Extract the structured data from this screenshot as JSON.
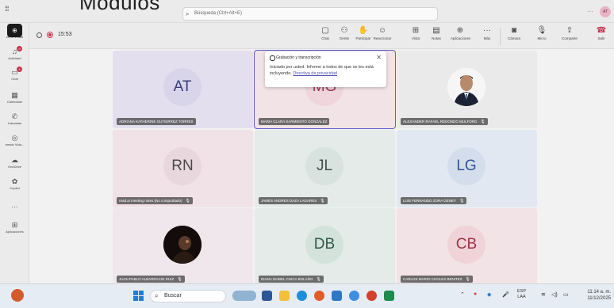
{
  "overlay_title": "Modulos",
  "titlebar": {
    "search_placeholder": "Búsqueda (Ctrl+Alt+E)",
    "more": "···",
    "avatar": "AT"
  },
  "rail": {
    "items": [
      {
        "label": "ermd Virtual",
        "icon": "teams-icon",
        "badge": ""
      },
      {
        "label": "Actividad",
        "icon": "bell-icon",
        "badge": "9"
      },
      {
        "label": "Chat",
        "icon": "chat-icon",
        "badge": "4"
      },
      {
        "label": "Calendario",
        "icon": "calendar-icon",
        "badge": ""
      },
      {
        "label": "Llamadas",
        "icon": "phone-icon",
        "badge": ""
      },
      {
        "label": "eesde Vida...",
        "icon": "lightbulb-icon",
        "badge": ""
      },
      {
        "label": "OneDrive",
        "icon": "cloud-icon",
        "badge": ""
      },
      {
        "label": "Copilot",
        "icon": "copilot-icon",
        "badge": ""
      },
      {
        "label": "···",
        "icon": "more-icon",
        "badge": ""
      },
      {
        "label": "Aplicaciones",
        "icon": "apps-icon",
        "badge": ""
      }
    ]
  },
  "toolbar": {
    "timer": "15:53",
    "buttons": [
      {
        "label": "Chat",
        "icon": "chat-icon"
      },
      {
        "label": "Gente",
        "icon": "people-icon"
      },
      {
        "label": "Participar",
        "icon": "raise-hand-icon"
      },
      {
        "label": "Reaccionar",
        "icon": "emoji-icon"
      },
      {
        "label": "Vista",
        "icon": "grid-view-icon"
      },
      {
        "label": "Notas",
        "icon": "notes-icon"
      },
      {
        "label": "Aplicaciones",
        "icon": "apps-add-icon"
      },
      {
        "label": "Más",
        "icon": "more-icon"
      },
      {
        "label": "Cámara",
        "icon": "camera-off-icon"
      },
      {
        "label": "Micro",
        "icon": "mic-icon"
      },
      {
        "label": "Comparte",
        "icon": "share-icon"
      }
    ],
    "leave": "Salir"
  },
  "popup": {
    "title": "Grabación y transcripción",
    "body": "Iniciado por usted. Informe a todos de que se les está incluyendo.",
    "link": "Directiva de privacidad"
  },
  "participants": [
    {
      "initials": "AT",
      "name": "ADRIANA KATHERINE GUTIERREZ TORRES",
      "muted": false,
      "photo": false,
      "bg": "#e3dfee",
      "avbg": "#d8d5ea",
      "avcolor": "#3a3d7a"
    },
    {
      "initials": "MG",
      "name": "MARIA CLARA SARMIENTO GONZALEZ",
      "muted": false,
      "photo": false,
      "bg": "#f2e3e7",
      "avbg": "#f0d5dc",
      "avcolor": "#9c3553"
    },
    {
      "initials": "",
      "name": "ALEXANDER RAFAEL REDONDO MULFORD",
      "muted": true,
      "photo": true,
      "bg": "#eaeaea",
      "avbg": "#f6f6f6",
      "avcolor": "#333"
    },
    {
      "initials": "RN",
      "name": "read.ai meeting notes (No comprobado)",
      "muted": true,
      "photo": false,
      "bg": "#f0e2e7",
      "avbg": "#e8d8dd",
      "avcolor": "#4a4a4a"
    },
    {
      "initials": "JL",
      "name": "JAMES ANDRES DAZA LAGARES",
      "muted": true,
      "photo": false,
      "bg": "#e4ebe9",
      "avbg": "#d8e2df",
      "avcolor": "#3f4f4a"
    },
    {
      "initials": "LG",
      "name": "LUIS FERNANDO ZORA GENEY",
      "muted": true,
      "photo": false,
      "bg": "#e2e8f1",
      "avbg": "#d3ddec",
      "avcolor": "#2f5793"
    },
    {
      "initials": "",
      "name": "JUAN PABLO ALBARRACIN RUIZ",
      "muted": true,
      "photo": true,
      "bg": "#efe7ec",
      "avbg": "#1c1410",
      "avcolor": "#fff"
    },
    {
      "initials": "DB",
      "name": "DIANA ISABEL CHICA BOLAÑO",
      "muted": true,
      "photo": false,
      "bg": "#e4ebe8",
      "avbg": "#d4e2dc",
      "avcolor": "#31594b"
    },
    {
      "initials": "CB",
      "name": "CARLOS MARIO CHOLES BENITEZ",
      "muted": true,
      "photo": false,
      "bg": "#f1e3e6",
      "avbg": "#f0d3d9",
      "avcolor": "#9c3343"
    }
  ],
  "taskbar": {
    "search": "Buscar",
    "lang_top": "ESP",
    "lang_bottom": "LAA",
    "time": "11:14 a. m.",
    "date": "11/12/2025"
  }
}
